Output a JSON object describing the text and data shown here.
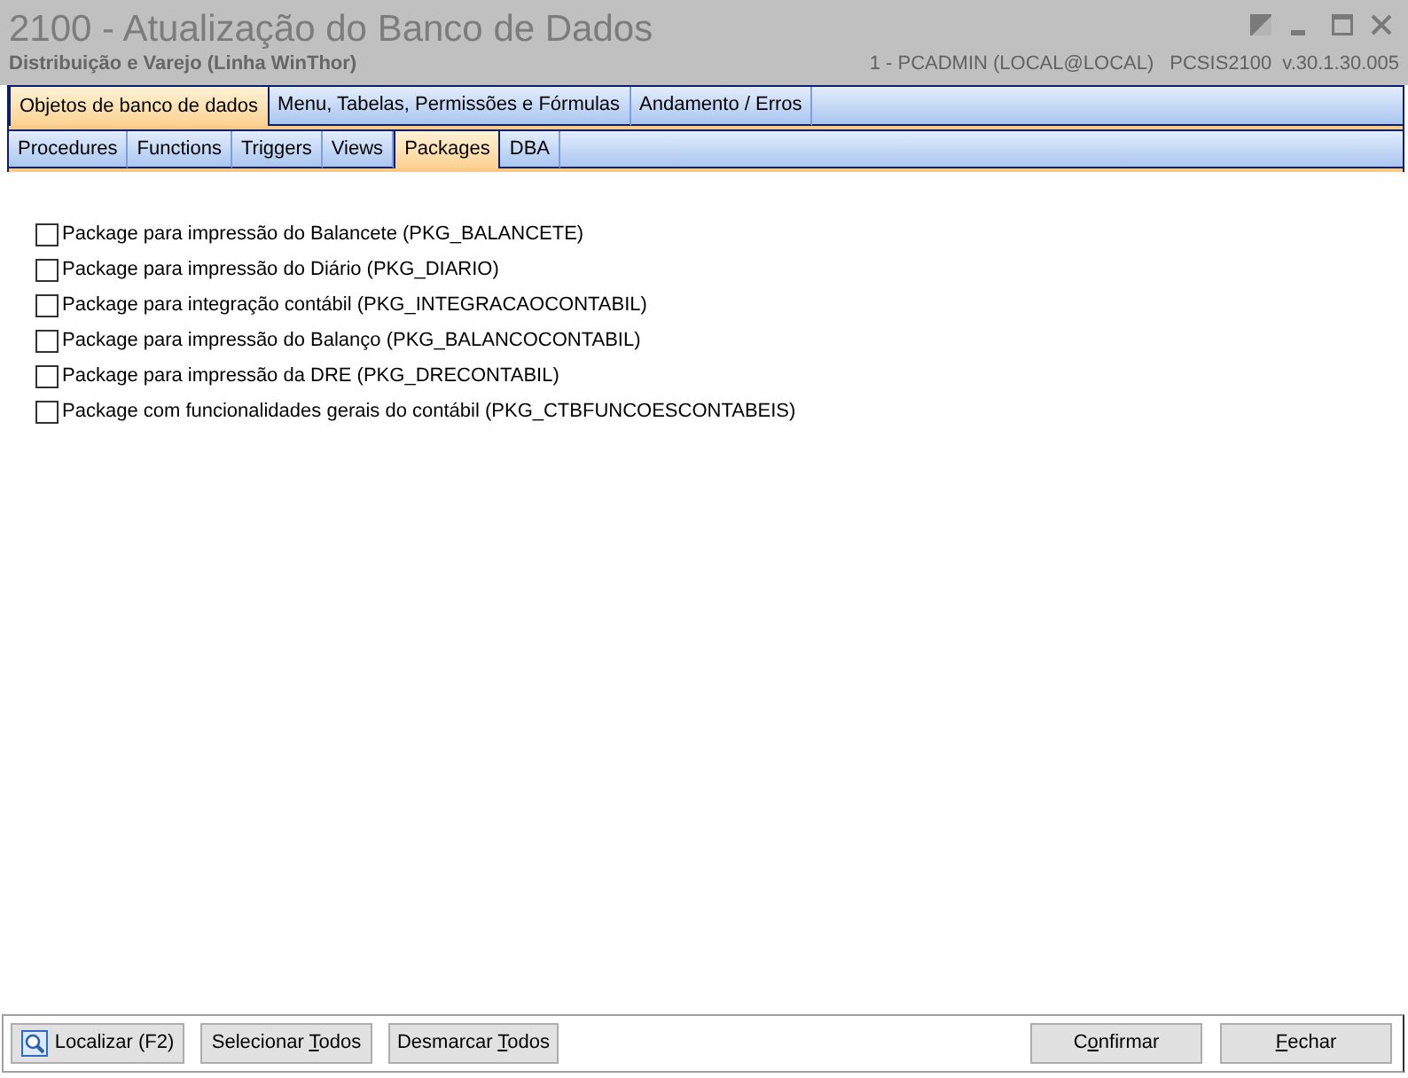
{
  "window": {
    "title": "2100 - Atualização do Banco de Dados",
    "subtitle": "Distribuição e Varejo (Linha WinThor)",
    "user": "1 - PCADMIN (LOCAL@LOCAL)",
    "program": "PCSIS2100",
    "version": "v.30.1.30.005"
  },
  "tabs": [
    {
      "label": "Objetos de banco de dados",
      "selected": true
    },
    {
      "label": "Menu, Tabelas, Permissões e Fórmulas",
      "selected": false
    },
    {
      "label": "Andamento / Erros",
      "selected": false
    }
  ],
  "subtabs": [
    {
      "label": "Procedures",
      "selected": false
    },
    {
      "label": "Functions",
      "selected": false
    },
    {
      "label": "Triggers",
      "selected": false
    },
    {
      "label": "Views",
      "selected": false
    },
    {
      "label": "Packages",
      "selected": true
    },
    {
      "label": "DBA",
      "selected": false
    }
  ],
  "packages": [
    {
      "label": "Package para impressão do Balancete (PKG_BALANCETE)",
      "checked": false
    },
    {
      "label": "Package para impressão do Diário (PKG_DIARIO)",
      "checked": false
    },
    {
      "label": "Package para integração contábil (PKG_INTEGRACAOCONTABIL)",
      "checked": false
    },
    {
      "label": "Package para impressão do Balanço (PKG_BALANCOCONTABIL)",
      "checked": false
    },
    {
      "label": "Package para impressão da DRE (PKG_DRECONTABIL)",
      "checked": false
    },
    {
      "label": "Package com funcionalidades gerais do contábil (PKG_CTBFUNCOESCONTABEIS)",
      "checked": false
    }
  ],
  "left_buttons": [
    {
      "kind": "search",
      "text": "Localizar (F2)"
    },
    {
      "kind": "plain",
      "text": "Selecionar ",
      "mnemonic": "T",
      "text_after": "odos"
    },
    {
      "kind": "plain",
      "text": "Desmarcar ",
      "mnemonic": "T",
      "text_after": "odos"
    }
  ],
  "right_buttons": [
    {
      "text": "C",
      "mnemonic": "o",
      "text_after": "nfirmar"
    },
    {
      "mnemonic": "F",
      "text_after": "echar"
    }
  ]
}
